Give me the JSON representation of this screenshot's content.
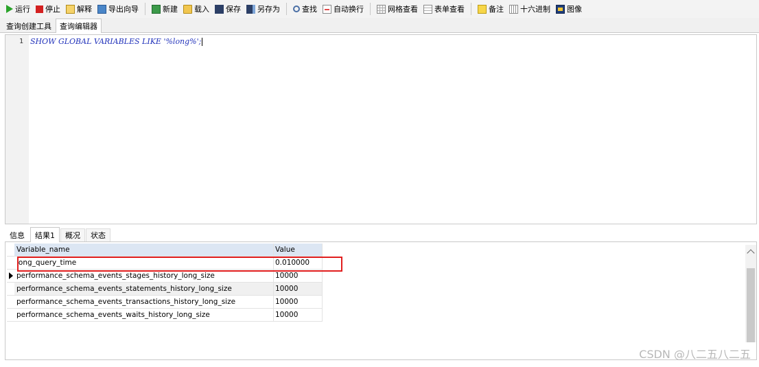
{
  "toolbar": {
    "buttons": [
      {
        "label": "运行",
        "icon": "run-icon"
      },
      {
        "label": "停止",
        "icon": "stop-icon"
      },
      {
        "label": "解释",
        "icon": "explain-icon"
      },
      {
        "label": "导出向导",
        "icon": "export-wizard-icon"
      },
      {
        "label": "新建",
        "icon": "new-icon"
      },
      {
        "label": "载入",
        "icon": "load-icon"
      },
      {
        "label": "保存",
        "icon": "save-icon"
      },
      {
        "label": "另存为",
        "icon": "save-as-icon"
      },
      {
        "label": "查找",
        "icon": "find-icon"
      },
      {
        "label": "自动换行",
        "icon": "word-wrap-icon"
      },
      {
        "label": "网格查看",
        "icon": "grid-view-icon"
      },
      {
        "label": "表单查看",
        "icon": "form-view-icon"
      },
      {
        "label": "备注",
        "icon": "note-icon"
      },
      {
        "label": "十六进制",
        "icon": "hex-icon"
      },
      {
        "label": "图像",
        "icon": "image-icon"
      }
    ]
  },
  "editor_tabs": [
    "查询创建工具",
    "查询编辑器"
  ],
  "editor": {
    "line_number": "1",
    "code": "SHOW GLOBAL VARIABLES LIKE '%long%';"
  },
  "result_tabs": [
    "信息",
    "结果1",
    "概况",
    "状态"
  ],
  "results": {
    "columns": [
      "Variable_name",
      "Value"
    ],
    "rows": [
      {
        "name": "long_query_time",
        "value": "0.010000"
      },
      {
        "name": "performance_schema_events_stages_history_long_size",
        "value": "10000"
      },
      {
        "name": "performance_schema_events_statements_history_long_size",
        "value": "10000"
      },
      {
        "name": "performance_schema_events_transactions_history_long_size",
        "value": "10000"
      },
      {
        "name": "performance_schema_events_waits_history_long_size",
        "value": "10000"
      }
    ]
  },
  "watermark": "CSDN @八二五八二五",
  "colors": {
    "highlight": "#e11d1d",
    "code": "#2233bb",
    "header_bg": "#dce6f3"
  }
}
